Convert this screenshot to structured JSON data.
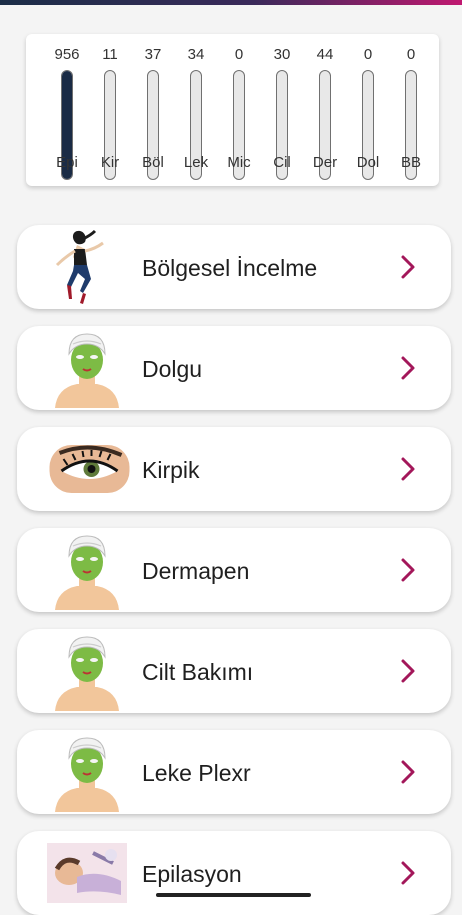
{
  "stats": [
    {
      "count": "956",
      "label": "Epi",
      "fill": 1.0
    },
    {
      "count": "11",
      "label": "Kir",
      "fill": 0.0
    },
    {
      "count": "37",
      "label": "Böl",
      "fill": 0.0
    },
    {
      "count": "34",
      "label": "Lek",
      "fill": 0.0
    },
    {
      "count": "0",
      "label": "Mic",
      "fill": 0.0
    },
    {
      "count": "30",
      "label": "Cil",
      "fill": 0.0
    },
    {
      "count": "44",
      "label": "Der",
      "fill": 0.0
    },
    {
      "count": "0",
      "label": "Dol",
      "fill": 0.0
    },
    {
      "count": "0",
      "label": "BB",
      "fill": 0.0
    }
  ],
  "categories": [
    {
      "title": "Bölgesel İncelme",
      "icon": "dancing-woman-icon"
    },
    {
      "title": "Dolgu",
      "icon": "face-mask-icon"
    },
    {
      "title": "Kirpik",
      "icon": "eye-lashes-icon"
    },
    {
      "title": "Dermapen",
      "icon": "face-mask-icon"
    },
    {
      "title": "Cilt Bakımı",
      "icon": "face-mask-icon"
    },
    {
      "title": "Leke Plexr",
      "icon": "face-mask-icon"
    },
    {
      "title": "Epilasyon",
      "icon": "epilation-icon"
    }
  ],
  "colors": {
    "accent": "#a3175a",
    "tube_fill": "#1a2b45"
  }
}
